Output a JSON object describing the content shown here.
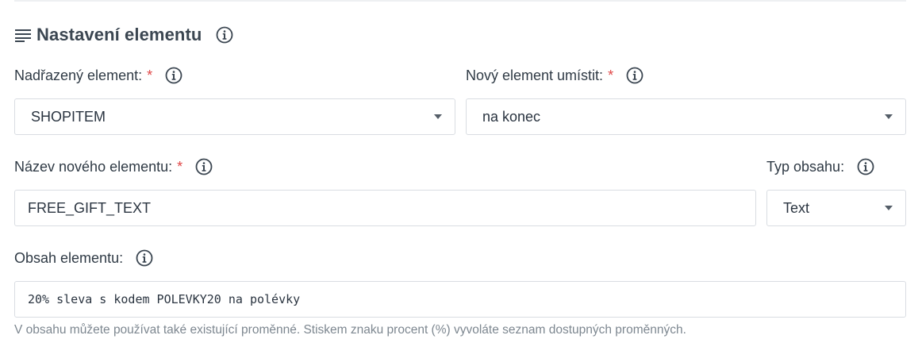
{
  "section": {
    "title": "Nastavení elementu",
    "title_icon": "lines-icon",
    "info_icon": "info-icon"
  },
  "parent_element": {
    "label": "Nadřazený element:",
    "required_mark": "*",
    "value": "SHOPITEM"
  },
  "placement": {
    "label": "Nový element umístit:",
    "required_mark": "*",
    "value": "na konec"
  },
  "element_name": {
    "label": "Název nového elementu:",
    "required_mark": "*",
    "value": "FREE_GIFT_TEXT"
  },
  "content_type": {
    "label": "Typ obsahu:",
    "value": "Text"
  },
  "element_content": {
    "label": "Obsah elementu:",
    "value": "20% sleva s kodem POLEVKY20 na polévky",
    "help": "V obsahu můžete používat také existující proměnné. Stiskem znaku procent (%) vyvoláte seznam dostupných proměnných."
  },
  "colors": {
    "required": "#e04545",
    "border": "#d9dde2",
    "help_text": "#7d8790"
  }
}
